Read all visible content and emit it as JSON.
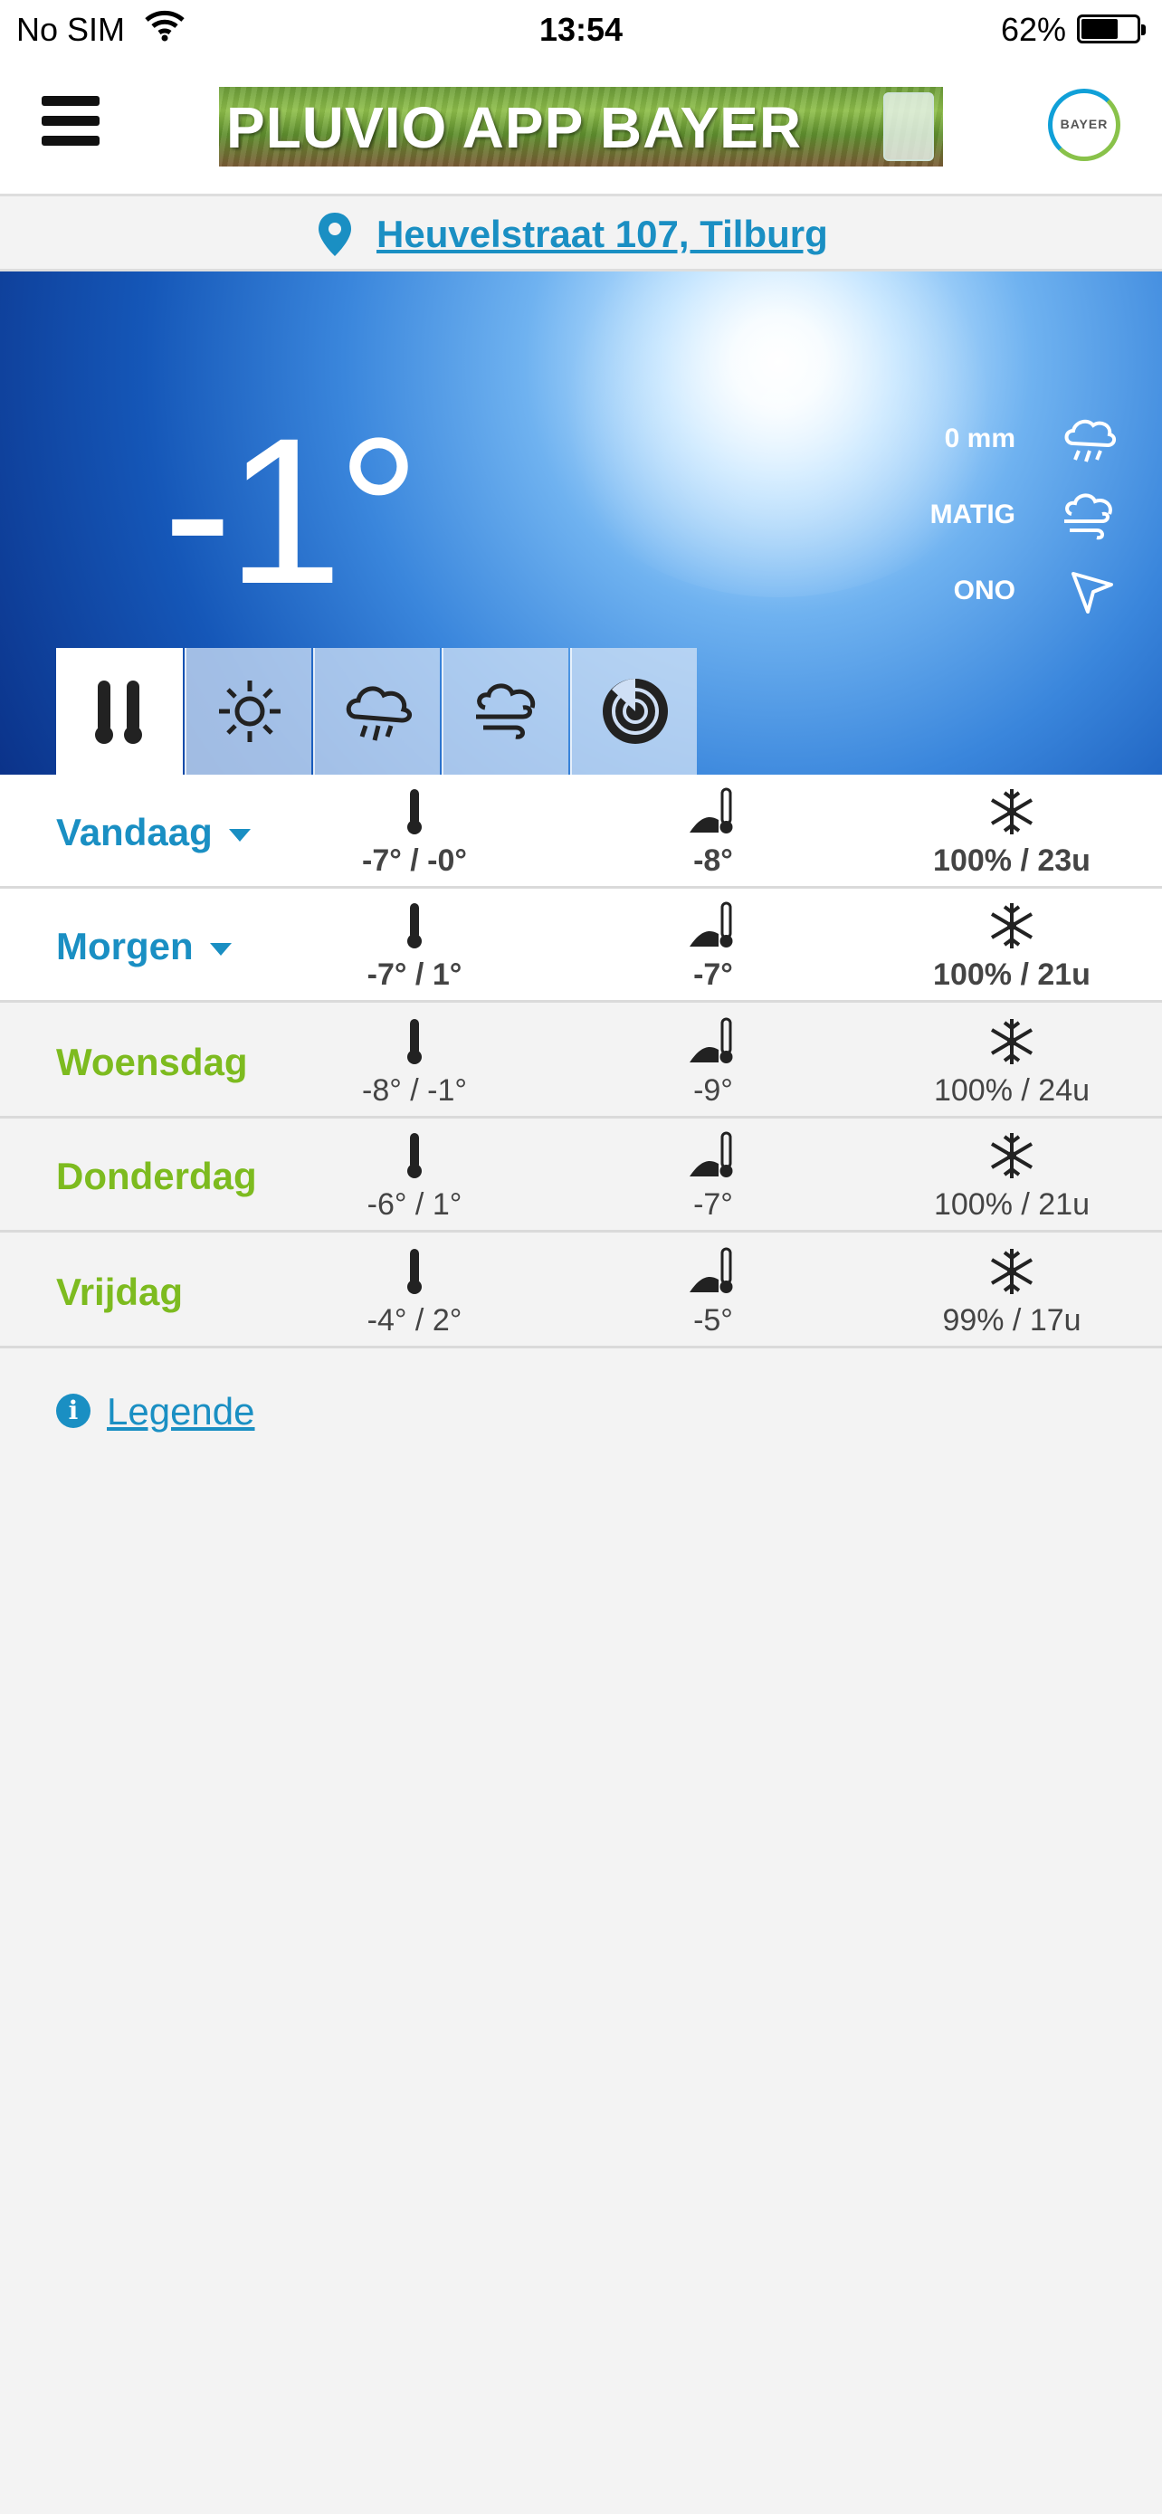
{
  "status_bar": {
    "carrier": "No SIM",
    "time": "13:54",
    "battery": "62%"
  },
  "header": {
    "banner_title": "PLUVIO APP BAYER",
    "logo_text": "BAYER"
  },
  "location": {
    "address": "Heuvelstraat 107, Tilburg"
  },
  "current": {
    "temperature": "-1°",
    "rain": "0 mm",
    "wind_strength": "MATIG",
    "wind_direction": "ONO"
  },
  "tabs": [
    {
      "name": "temperature-tab",
      "icon": "thermometer-icon",
      "active": true
    },
    {
      "name": "sun-tab",
      "icon": "sun-icon",
      "active": false
    },
    {
      "name": "rain-tab",
      "icon": "rain-cloud-icon",
      "active": false
    },
    {
      "name": "wind-tab",
      "icon": "wind-cloud-icon",
      "active": false
    },
    {
      "name": "radar-tab",
      "icon": "radar-icon",
      "active": false
    }
  ],
  "days": [
    {
      "name": "Vandaag",
      "expandable": true,
      "temp_range": "-7° / -0°",
      "ground_temp": "-8°",
      "frost": "100% / 23u"
    },
    {
      "name": "Morgen",
      "expandable": true,
      "temp_range": "-7° / 1°",
      "ground_temp": "-7°",
      "frost": "100% / 21u"
    },
    {
      "name": "Woensdag",
      "expandable": false,
      "temp_range": "-8° / -1°",
      "ground_temp": "-9°",
      "frost": "100% / 24u"
    },
    {
      "name": "Donderdag",
      "expandable": false,
      "temp_range": "-6° / 1°",
      "ground_temp": "-7°",
      "frost": "100% / 21u"
    },
    {
      "name": "Vrijdag",
      "expandable": false,
      "temp_range": "-4° / 2°",
      "ground_temp": "-5°",
      "frost": "99% / 17u"
    }
  ],
  "legend": {
    "label": "Legende"
  },
  "colors": {
    "link_blue": "#1a8fc3",
    "day_green": "#7dbb1f",
    "background": "#f3f3f3"
  }
}
